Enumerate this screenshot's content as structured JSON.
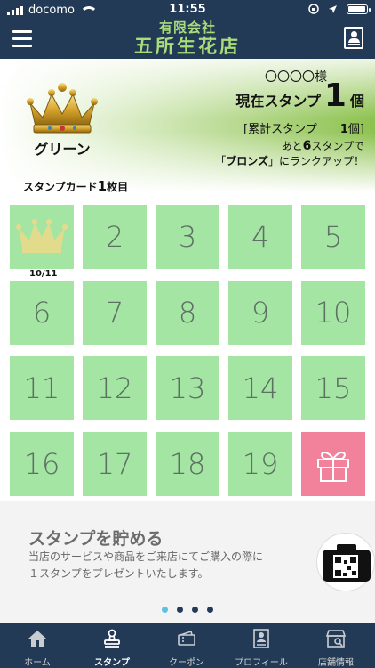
{
  "status_bar": {
    "carrier": "docomo",
    "time": "11:55"
  },
  "header": {
    "title_small": "有限会社",
    "title_large": "五所生花店"
  },
  "rank": {
    "name": "グリーン",
    "member_name": "〇〇〇〇様",
    "current_label": "現在スタンプ",
    "current_count": "1",
    "current_unit": "個",
    "total_label": "[累計スタンプ",
    "total_count": "1",
    "total_unit": "個]",
    "next_prefix": "あと",
    "next_count": "6",
    "next_suffix": "スタンプで",
    "next_rank_line_prefix": "「",
    "next_rank": "ブロンズ",
    "next_rank_line_suffix": "」にランクアップ！"
  },
  "card": {
    "prefix": "スタンプカード",
    "number": "1",
    "suffix": "枚目"
  },
  "stamps": {
    "first_stamp_date": "10/11",
    "cells": [
      "",
      "2",
      "3",
      "4",
      "5",
      "6",
      "7",
      "8",
      "9",
      "10",
      "11",
      "12",
      "13",
      "14",
      "15",
      "16",
      "17",
      "18",
      "19",
      ""
    ],
    "stamped_count": 1
  },
  "info": {
    "title": "スタンプを貯める",
    "description_line1": "当店のサービスや商品をご来店にてご購入の際に",
    "description_line2": "１スタンプをプレゼントいたします。",
    "page_total": 4,
    "page_active": 1
  },
  "tabs": {
    "home": "ホーム",
    "stamp": "スタンプ",
    "coupon": "クーポン",
    "profile": "プロフィール",
    "store": "店舗情報"
  },
  "colors": {
    "nav": "#233a57",
    "brand_text": "#a9dd7a",
    "cell": "#a4e5a4",
    "gift_cell": "#f2819c",
    "dot_active": "#5bc0e8"
  }
}
